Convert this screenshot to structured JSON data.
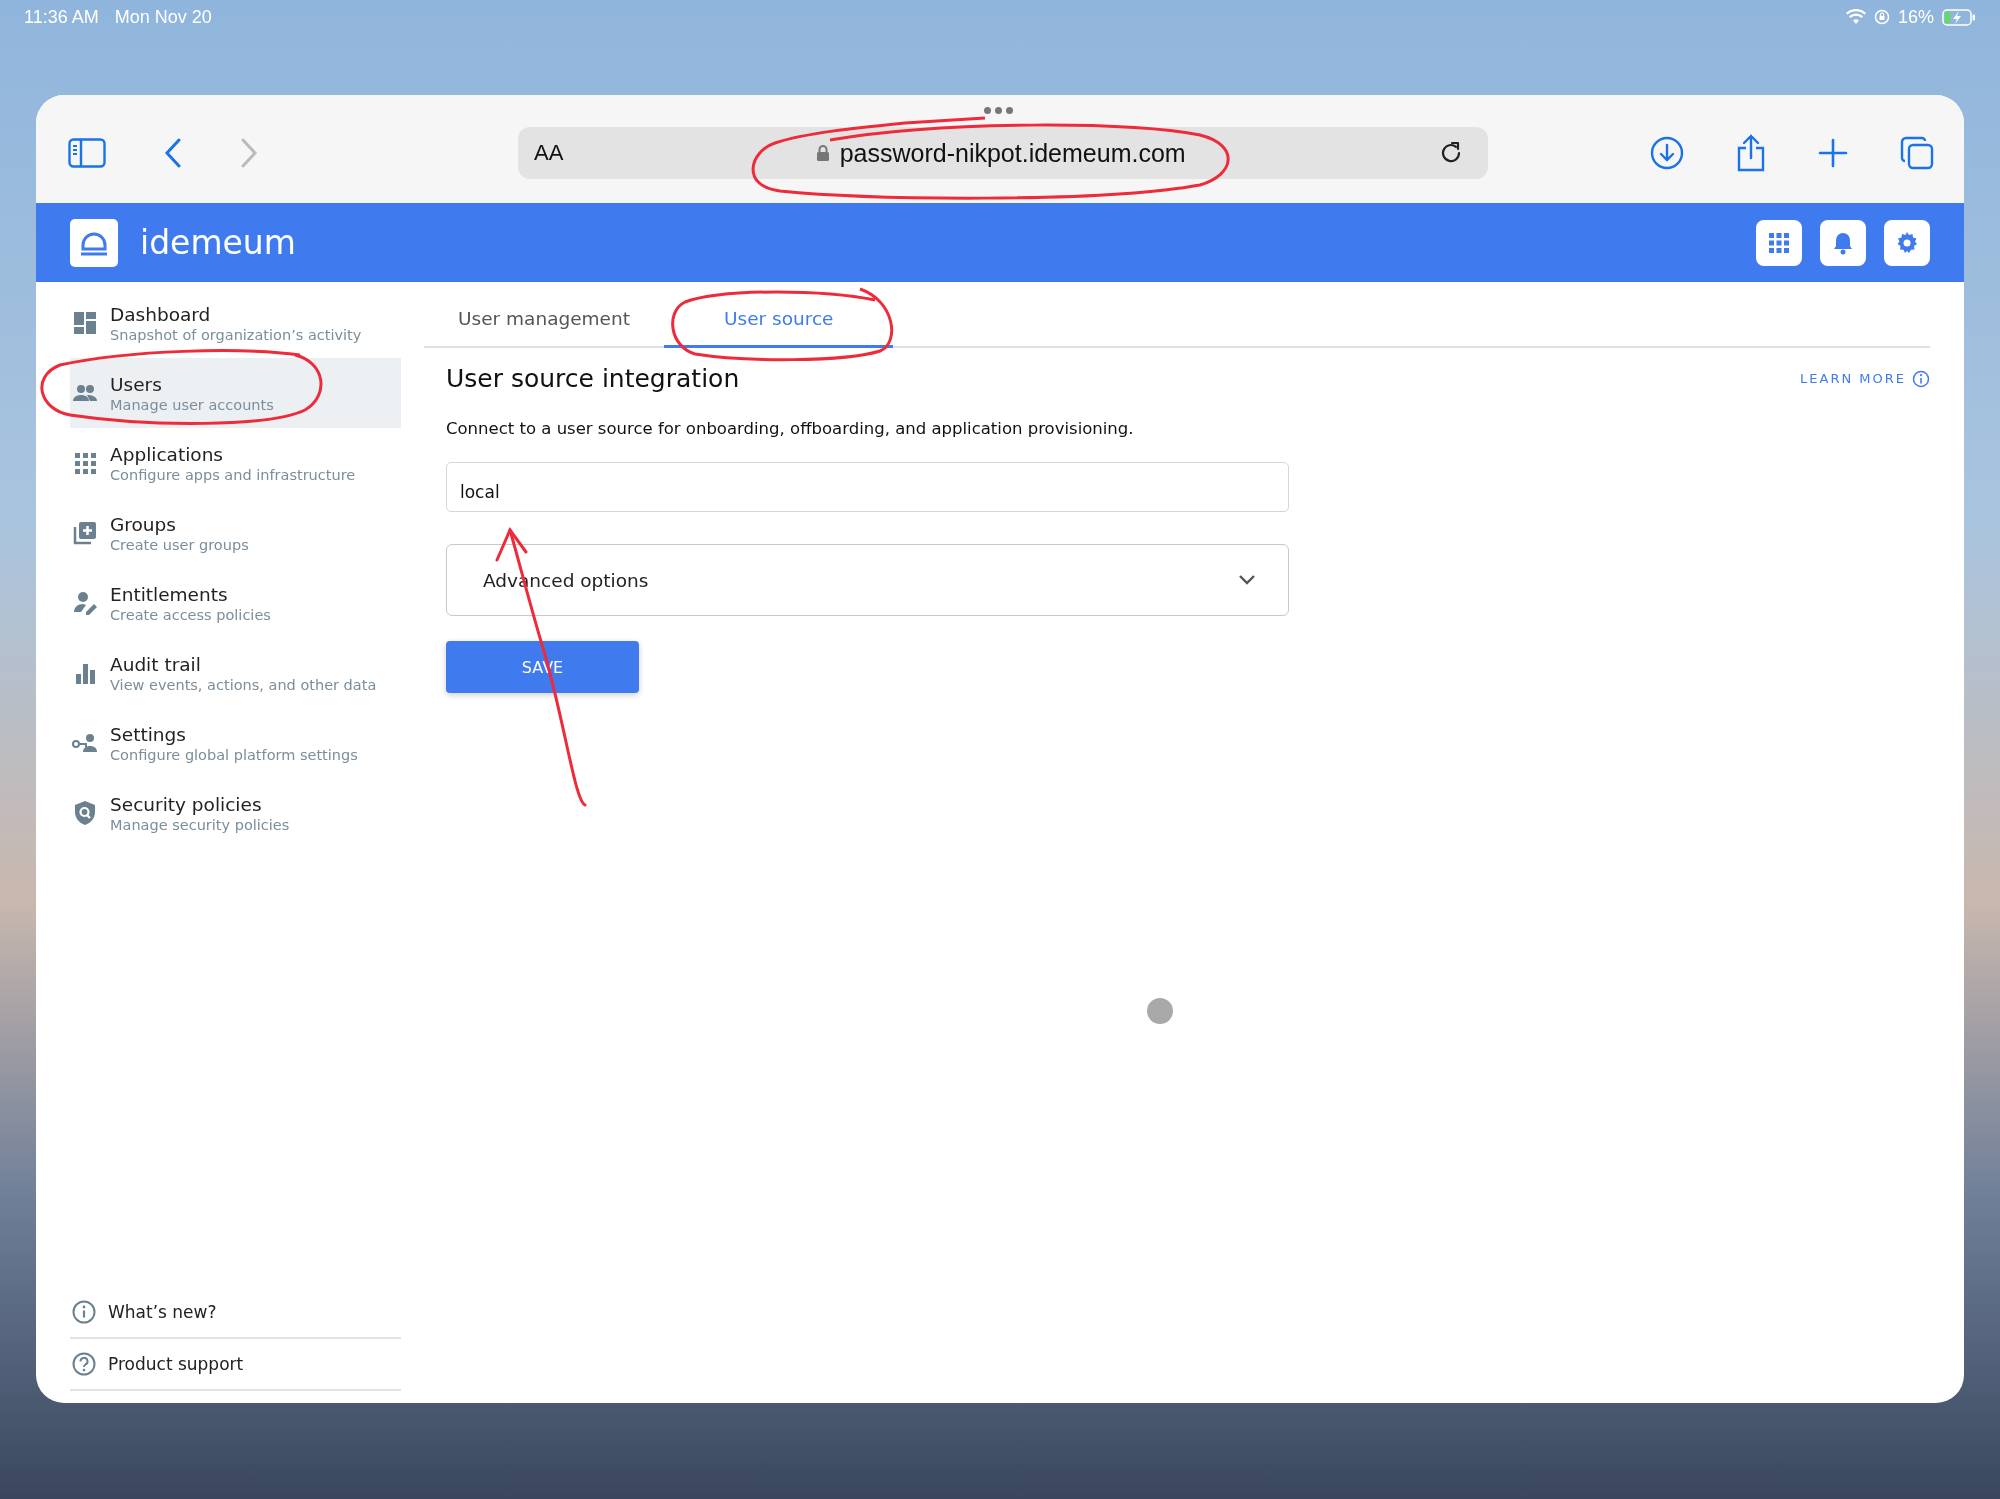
{
  "status_bar": {
    "time": "11:36 AM",
    "date": "Mon Nov 20",
    "battery": "16%"
  },
  "browser": {
    "text_size": "AA",
    "url": "password-nikpot.idemeum.com"
  },
  "app": {
    "name": "idemeum"
  },
  "sidebar": {
    "items": [
      {
        "title": "Dashboard",
        "subtitle": "Snapshot of organization’s activity",
        "selected": false
      },
      {
        "title": "Users",
        "subtitle": "Manage user accounts",
        "selected": true
      },
      {
        "title": "Applications",
        "subtitle": "Configure apps and infrastructure",
        "selected": false
      },
      {
        "title": "Groups",
        "subtitle": "Create user groups",
        "selected": false
      },
      {
        "title": "Entitlements",
        "subtitle": "Create access policies",
        "selected": false
      },
      {
        "title": "Audit trail",
        "subtitle": "View events, actions, and other data",
        "selected": false
      },
      {
        "title": "Settings",
        "subtitle": "Configure global platform settings",
        "selected": false
      },
      {
        "title": "Security policies",
        "subtitle": "Manage security policies",
        "selected": false
      }
    ],
    "footer_links": [
      "What’s new?",
      "Product support"
    ]
  },
  "tabs": [
    {
      "label": "User management",
      "selected": false
    },
    {
      "label": "User source",
      "selected": true
    }
  ],
  "section": {
    "title": "User source integration",
    "learn_more": "LEARN MORE",
    "description": "Connect to a user source for onboarding, offboarding, and application provisioning.",
    "source_field": {
      "value": "local"
    },
    "advanced_options": {
      "label": "Advanced options",
      "expanded": false
    },
    "save_button": "SAVE"
  }
}
